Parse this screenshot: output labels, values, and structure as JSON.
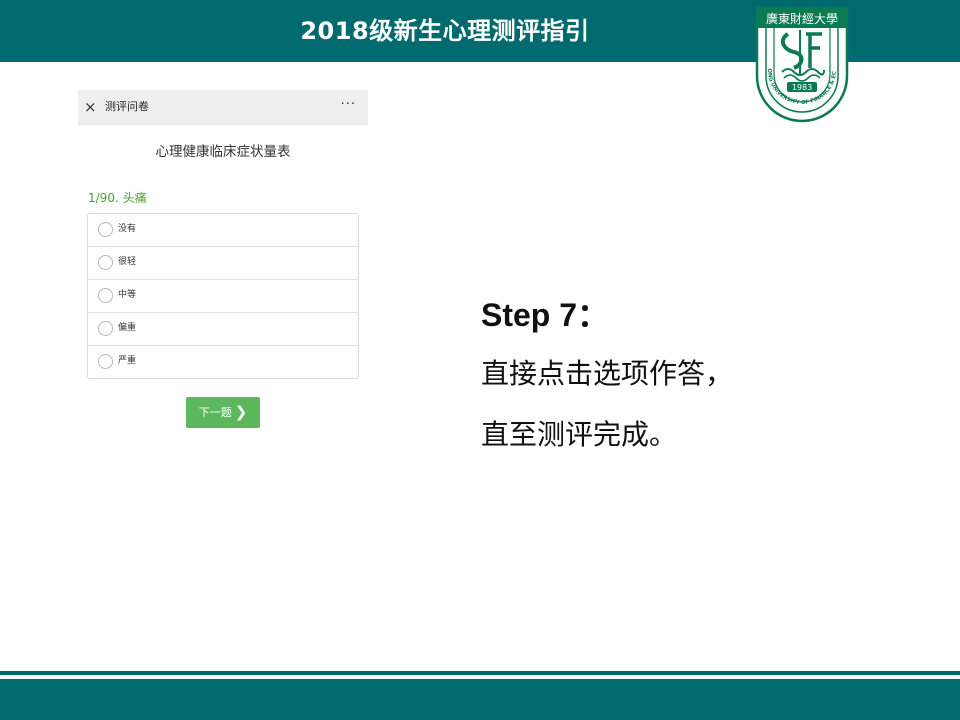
{
  "slide": {
    "title": "2018级新生心理测评指引"
  },
  "logo": {
    "top_text": "廣東財經大學",
    "ring_text": "GUANGDONG UNIVERSITY OF FINANCE & ECONOMICS",
    "year": "1983",
    "color": "#0b7a52"
  },
  "phone": {
    "close_icon": "×",
    "header_title": "测评问卷",
    "more_icon": "···",
    "survey_title": "心理健康临床症状量表",
    "question": "1/90. 头痛",
    "options": [
      "没有",
      "很轻",
      "中等",
      "偏重",
      "严重"
    ],
    "next_label": "下一题",
    "next_icon": "❯",
    "accent_color": "#5cb85c"
  },
  "instructions": {
    "heading": "Step 7：",
    "line1": "直接点击选项作答，",
    "line2": "直至测评完成。"
  },
  "colors": {
    "brand": "#006a6e"
  }
}
